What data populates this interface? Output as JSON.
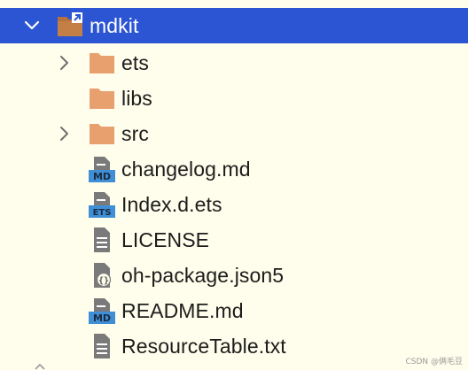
{
  "colors": {
    "background": "#FFFDEB",
    "selection": "#2B55D3",
    "folder": "#E8A06F",
    "file_badge": "#3F8FD6",
    "file_gray": "#8A8A8A"
  },
  "tree": {
    "module": {
      "label": "mdkit",
      "icon": "module-folder-icon",
      "expanded": true,
      "selected": true
    },
    "items": [
      {
        "label": "ets",
        "icon": "folder-icon",
        "collapsible": true
      },
      {
        "label": "libs",
        "icon": "folder-icon",
        "collapsible": false
      },
      {
        "label": "src",
        "icon": "folder-icon",
        "collapsible": true
      },
      {
        "label": "changelog.md",
        "icon": "markdown-file-icon",
        "badge": "MD"
      },
      {
        "label": "Index.d.ets",
        "icon": "ets-file-icon",
        "badge": "ETS"
      },
      {
        "label": "LICENSE",
        "icon": "text-file-icon"
      },
      {
        "label": "oh-package.json5",
        "icon": "json-file-icon"
      },
      {
        "label": "README.md",
        "icon": "markdown-file-icon",
        "badge": "MD"
      },
      {
        "label": "ResourceTable.txt",
        "icon": "text-file-icon"
      }
    ]
  },
  "watermark": "CSDN @俩毛豆"
}
